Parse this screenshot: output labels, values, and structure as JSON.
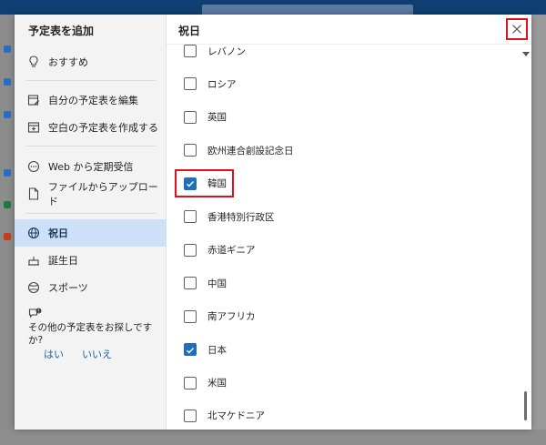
{
  "dialog": {
    "sidebar_title": "予定表を追加",
    "main_title": "祝日"
  },
  "sidebar": {
    "items": [
      {
        "label": "おすすめ",
        "icon": "lightbulb-icon"
      },
      {
        "label": "自分の予定表を編集",
        "icon": "edit-calendar-icon"
      },
      {
        "label": "空白の予定表を作成する",
        "icon": "blank-calendar-icon"
      },
      {
        "label": "Web から定期受信",
        "icon": "web-icon"
      },
      {
        "label": "ファイルからアップロード",
        "icon": "file-upload-icon"
      },
      {
        "label": "祝日",
        "icon": "globe-icon",
        "selected": true
      },
      {
        "label": "誕生日",
        "icon": "cake-icon"
      },
      {
        "label": "スポーツ",
        "icon": "sports-ball-icon"
      }
    ],
    "prompt": "その他の予定表をお探しですか?",
    "yes": "はい",
    "no": "いいえ"
  },
  "holidays": [
    {
      "label": "レバノン",
      "checked": false
    },
    {
      "label": "ロシア",
      "checked": false
    },
    {
      "label": "英国",
      "checked": false
    },
    {
      "label": "欧州連合創設記念日",
      "checked": false
    },
    {
      "label": "韓国",
      "checked": true,
      "highlighted": true
    },
    {
      "label": "香港特別行政区",
      "checked": false
    },
    {
      "label": "赤道ギニア",
      "checked": false
    },
    {
      "label": "中国",
      "checked": false
    },
    {
      "label": "南アフリカ",
      "checked": false
    },
    {
      "label": "日本",
      "checked": true
    },
    {
      "label": "米国",
      "checked": false
    },
    {
      "label": "北マケドニア",
      "checked": false
    }
  ],
  "colors": {
    "accent": "#1f6fb8",
    "highlight": "#e3101a",
    "selected_bg": "#cde0f7"
  }
}
